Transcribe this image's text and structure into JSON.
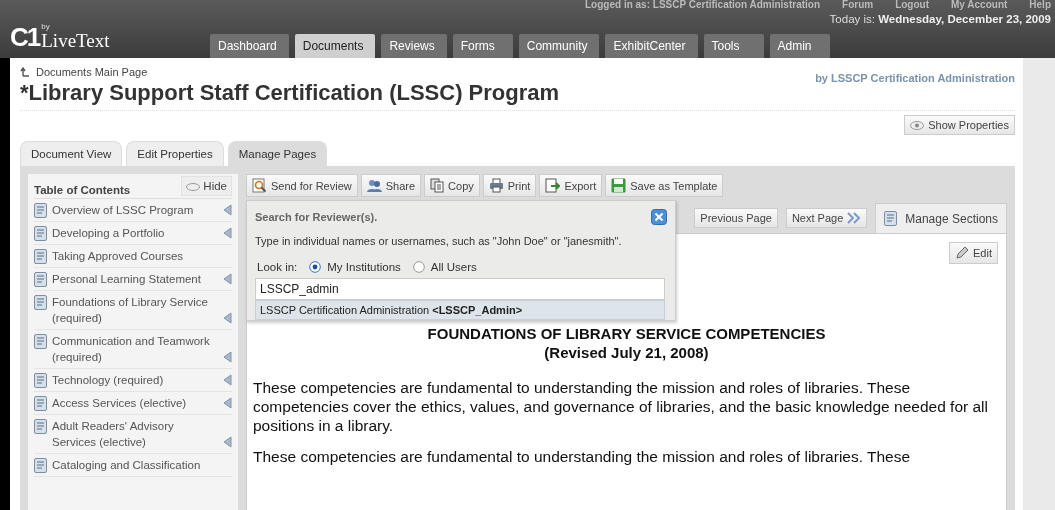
{
  "header": {
    "logo": {
      "mark": "C1",
      "by": "by",
      "name": "LiveText"
    },
    "top_links": [
      "Logged in as: LSSCP Certification Administration",
      "Forum",
      "Logout",
      "My Account",
      "Help"
    ],
    "date_label": "Today is:",
    "date": "Wednesday, December 23, 2009",
    "nav": [
      {
        "label": "Dashboard",
        "selected": false
      },
      {
        "label": "Documents",
        "selected": true
      },
      {
        "label": "Reviews",
        "selected": false
      },
      {
        "label": "Forms",
        "selected": false
      },
      {
        "label": "Community",
        "selected": false
      },
      {
        "label": "ExhibitCenter",
        "selected": false
      },
      {
        "label": "Tools",
        "selected": false
      },
      {
        "label": "Admin",
        "selected": false
      }
    ]
  },
  "breadcrumb": "Documents Main Page",
  "author": "by LSSCP Certification Administration",
  "title": "*Library Support Staff Certification (LSSC) Program",
  "show_properties": "Show Properties",
  "tabs": [
    {
      "label": "Document View",
      "selected": false
    },
    {
      "label": "Edit Properties",
      "selected": false
    },
    {
      "label": "Manage Pages",
      "selected": true
    }
  ],
  "sidebar": {
    "title": "Table of Contents",
    "hide": "Hide",
    "items": [
      {
        "label": "Overview of LSSC Program",
        "arrow": true
      },
      {
        "label": "Developing a Portfolio",
        "arrow": true
      },
      {
        "label": "Taking Approved Courses",
        "arrow": false
      },
      {
        "label": "Personal Learning Statement",
        "arrow": true
      },
      {
        "label": "Foundations of Library Service (required)",
        "arrow": true
      },
      {
        "label": "Communication and Teamwork (required)",
        "arrow": true
      },
      {
        "label": "Technology (required)",
        "arrow": true
      },
      {
        "label": "Access Services (elective)",
        "arrow": true
      },
      {
        "label": "Adult Readers' Advisory Services (elective)",
        "arrow": true
      },
      {
        "label": "Cataloging and Classification",
        "arrow": false
      }
    ]
  },
  "toolbar": [
    {
      "label": "Send for Review",
      "kind": "review"
    },
    {
      "label": "Share",
      "kind": "share"
    },
    {
      "label": "Copy",
      "kind": "copy"
    },
    {
      "label": "Print",
      "kind": "print"
    },
    {
      "label": "Export",
      "kind": "export"
    },
    {
      "label": "Save as Template",
      "kind": "template"
    }
  ],
  "page_nav": {
    "previous": "Previous Page",
    "next": "Next Page",
    "sections": "Manage Sections",
    "edit": "Edit"
  },
  "document": {
    "heading": "FOUNDATIONS OF LIBRARY SERVICE COMPETENCIES",
    "subheading": "(Revised July 21, 2008)",
    "paragraphs": [
      "These competencies are fundamental to understanding the mission and roles of libraries. These competencies cover the ethics, values, and governance of libraries, and the basic knowledge needed for all positions in a library.",
      "These competencies are fundamental to understanding the mission and roles of libraries. These"
    ]
  },
  "popup": {
    "title": "Search for Reviewer(s).",
    "instructions": "Type in individual names or usernames, such as \"John Doe\" or \"janesmith\".",
    "look_in": "Look in:",
    "options": [
      {
        "label": "My Institutions",
        "selected": true
      },
      {
        "label": "All Users",
        "selected": false
      }
    ],
    "value": "LSSCP_admin",
    "suggestion": "LSSCP Certification Administration **<LSSCP_Admin>**"
  }
}
